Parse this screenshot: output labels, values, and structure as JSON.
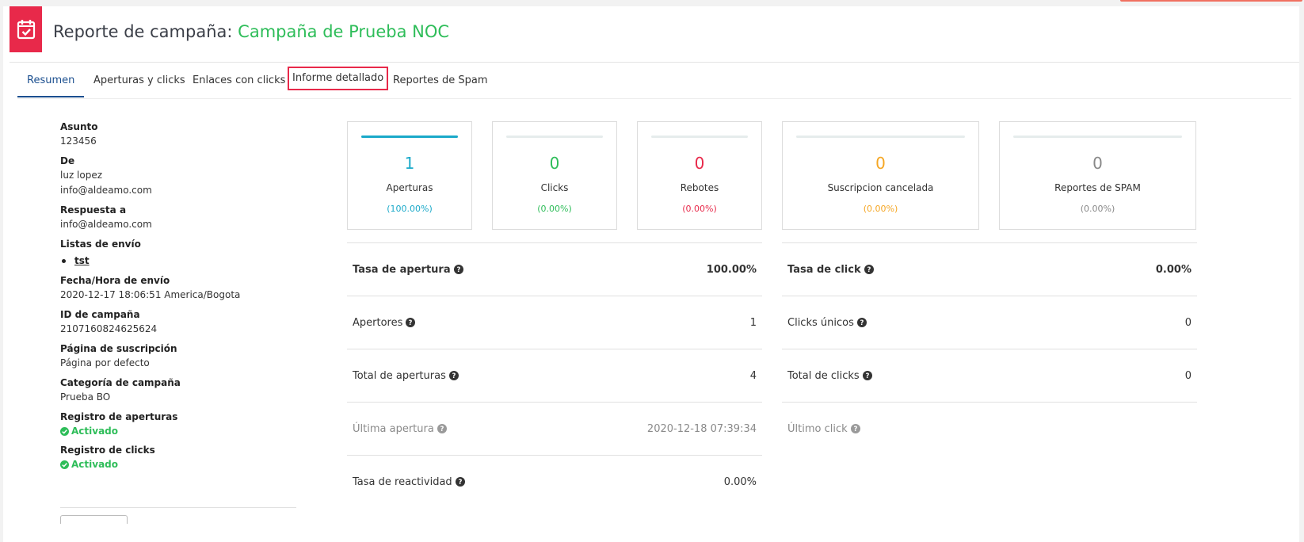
{
  "header": {
    "title_prefix": "Reporte de campaña:",
    "campaign_name": "Campaña de Prueba NOC",
    "icon": "calendar-check-icon"
  },
  "tabs": [
    {
      "label": "Resumen",
      "active": true
    },
    {
      "label": "Aperturas y clicks"
    },
    {
      "label": "Enlaces con clicks"
    },
    {
      "label": "Informe detallado",
      "highlighted": true
    },
    {
      "label": "Reportes de Spam"
    }
  ],
  "details": {
    "asunto_label": "Asunto",
    "asunto_value": "123456",
    "de_label": "De",
    "de_name": "luz lopez",
    "de_email": "info@aldeamo.com",
    "respuesta_label": "Respuesta a",
    "respuesta_value": "info@aldeamo.com",
    "listas_label": "Listas de envío",
    "listas_items": [
      "tst"
    ],
    "fecha_label": "Fecha/Hora de envío",
    "fecha_value": "2020-12-17 18:06:51 America/Bogota",
    "id_label": "ID de campaña",
    "id_value": "2107160824625624",
    "pagina_label": "Página de suscripción",
    "pagina_value": "Página por defecto",
    "categoria_label": "Categoría de campaña",
    "categoria_value": "Prueba BO",
    "reg_aperturas_label": "Registro de aperturas",
    "reg_aperturas_value": "Activado",
    "reg_clicks_label": "Registro de clicks",
    "reg_clicks_value": "Activado"
  },
  "cards": [
    {
      "value": "1",
      "label": "Aperturas",
      "percent": "(100.00%)",
      "color": "#1aa9c9",
      "fill": 1.0
    },
    {
      "value": "0",
      "label": "Clicks",
      "percent": "(0.00%)",
      "color": "#2ebd59",
      "fill": 0.0
    },
    {
      "value": "0",
      "label": "Rebotes",
      "percent": "(0.00%)",
      "color": "#e8294a",
      "fill": 0.0
    },
    {
      "value": "0",
      "label": "Suscripcion cancelada",
      "percent": "(0.00%)",
      "color": "#f5a623",
      "fill": 0.0
    },
    {
      "value": "0",
      "label": "Reportes de SPAM",
      "percent": "(0.00%)",
      "color": "#888888",
      "fill": 0.0
    }
  ],
  "stats_left": [
    {
      "label": "Tasa de apertura",
      "value": "100.00%",
      "bold": true
    },
    {
      "label": "Apertores",
      "value": "1"
    },
    {
      "label": "Total de aperturas",
      "value": "4"
    },
    {
      "label": "Última apertura",
      "value": "2020-12-18 07:39:34",
      "muted": true
    },
    {
      "label": "Tasa de reactividad",
      "value": "0.00%"
    }
  ],
  "stats_right": [
    {
      "label": "Tasa de click",
      "value": "0.00%",
      "bold": true
    },
    {
      "label": "Clicks únicos",
      "value": "0"
    },
    {
      "label": "Total de clicks",
      "value": "0"
    },
    {
      "label": "Último click",
      "value": "",
      "muted": true
    }
  ],
  "colors": {
    "brand": "#e8294a",
    "green": "#2ebd59",
    "tab_active": "#1b4f8f"
  }
}
